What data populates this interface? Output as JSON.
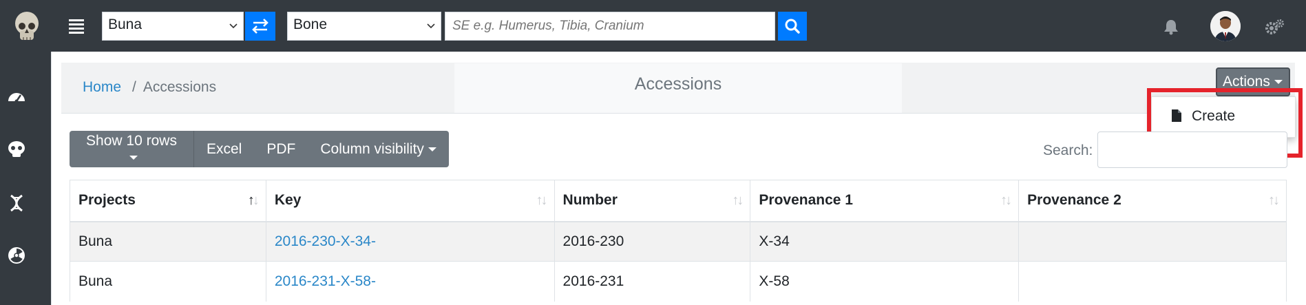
{
  "navbar": {
    "project_select": "Buna",
    "type_select": "Bone",
    "search_placeholder": "SE e.g. Humerus, Tibia, Cranium"
  },
  "breadcrumb": {
    "home": "Home",
    "separator": "/",
    "current": "Accessions"
  },
  "page_title": "Accessions",
  "actions": {
    "label": "Actions",
    "menu": [
      {
        "icon": "file-icon",
        "label": "Create"
      }
    ]
  },
  "toolbar": {
    "show_rows": "Show 10 rows",
    "excel": "Excel",
    "pdf": "PDF",
    "column_visibility": "Column visibility",
    "search_label": "Search:"
  },
  "table": {
    "columns": [
      "Projects",
      "Key",
      "Number",
      "Provenance 1",
      "Provenance 2"
    ],
    "rows": [
      [
        "Buna",
        "2016-230-X-34-",
        "2016-230",
        "X-34",
        ""
      ],
      [
        "Buna",
        "2016-231-X-58-",
        "2016-231",
        "X-58",
        ""
      ]
    ]
  },
  "colors": {
    "navbar": "#343a40",
    "primary": "#007bff",
    "link": "#2a87c8",
    "highlight": "#e5232b",
    "button": "#6c757d"
  }
}
